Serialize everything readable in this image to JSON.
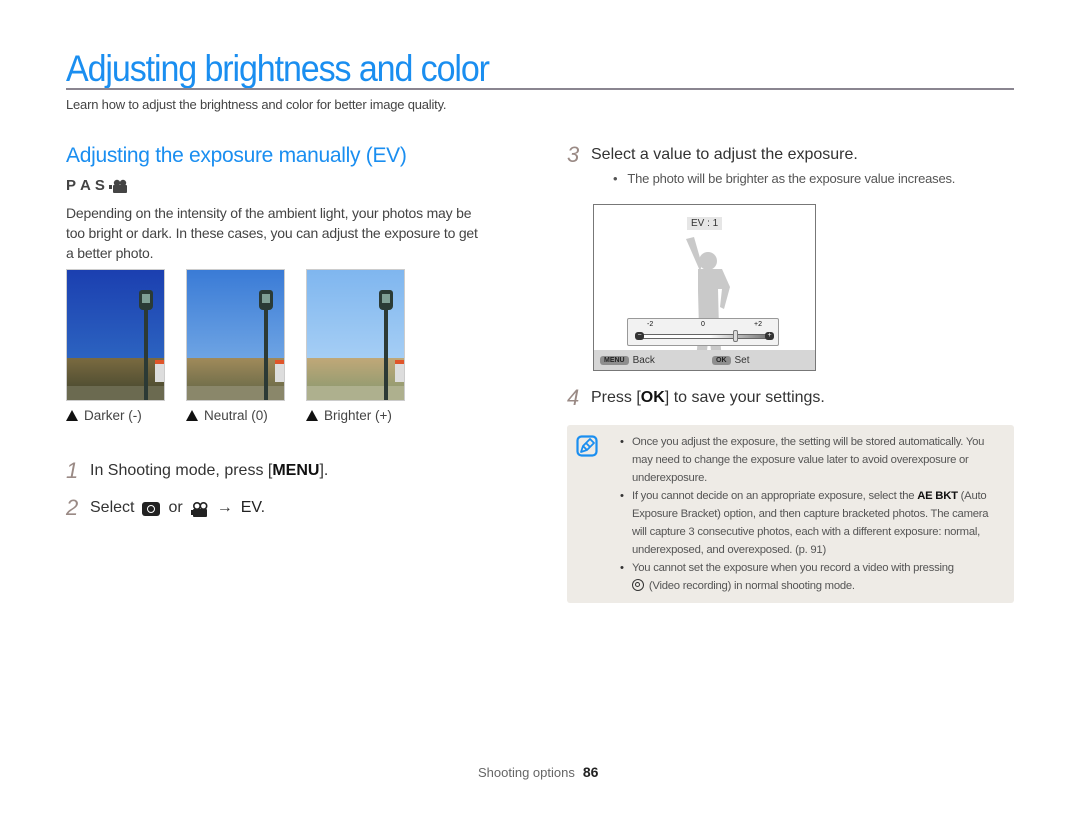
{
  "page": {
    "title": "Adjusting brightness and color",
    "intro": "Learn how to adjust the brightness and color for better image quality."
  },
  "section": {
    "title": "Adjusting the exposure manually (EV)",
    "modes": [
      "P",
      "A",
      "S"
    ],
    "modes_icon": "movie-mode-icon",
    "description": "Depending on the intensity of the ambient light, your photos may be too bright or dark. In these cases, you can adjust the exposure to get a better photo."
  },
  "photos": [
    {
      "caption": "Darker (-)",
      "sky": "#1b3fb0",
      "sky_bottom": "#3474c8"
    },
    {
      "caption": "Neutral (0)",
      "sky": "#3a7bd6",
      "sky_bottom": "#86b7ea"
    },
    {
      "caption": "Brighter (+)",
      "sky": "#7fb6ef",
      "sky_bottom": "#b7d9f7"
    }
  ],
  "steps": [
    {
      "num": "1",
      "text_before": "In Shooting mode, press [",
      "key": "MENU",
      "text_after": "]."
    },
    {
      "num": "2",
      "text_before": "Select",
      "or": "or",
      "arrow": "→",
      "key": "EV",
      "text_after": "."
    },
    {
      "num": "3",
      "text": "Select a value to adjust the exposure."
    },
    {
      "num": "4",
      "text_before": "Press [",
      "key": "OK",
      "text_after": "] to save your settings."
    }
  ],
  "step3_bullet": "The photo will be brighter as the exposure value increases.",
  "camera_screen": {
    "ev_label": "EV : 1",
    "ev_value": 1,
    "ev_min": -2,
    "ev_max": 2,
    "ticks": [
      "-2",
      "0",
      "+2"
    ],
    "back_key": "MENU",
    "back_label": "Back",
    "set_key": "OK",
    "set_label": "Set"
  },
  "note": {
    "items": [
      {
        "text": "Once you adjust the exposure, the setting will be stored automatically. You may need to change the exposure value later to avoid overexposure or underexposure."
      },
      {
        "before": "If you cannot decide on an appropriate exposure, select the ",
        "bold": "AE BKT",
        "after": " (Auto Exposure Bracket) option, and then capture bracketed photos. The camera will capture 3 consecutive photos, each with a different exposure: normal, underexposed, and overexposed. (p. 91)"
      },
      {
        "before": "You cannot set the exposure when you record a video with pressing ",
        "after": " (Video recording) in normal shooting mode."
      }
    ]
  },
  "footer": {
    "section": "Shooting options",
    "page": "86"
  },
  "colors": {
    "accent": "#1a8ef0",
    "note_bg": "#eeebe6",
    "step_num": "#9a8a85"
  }
}
